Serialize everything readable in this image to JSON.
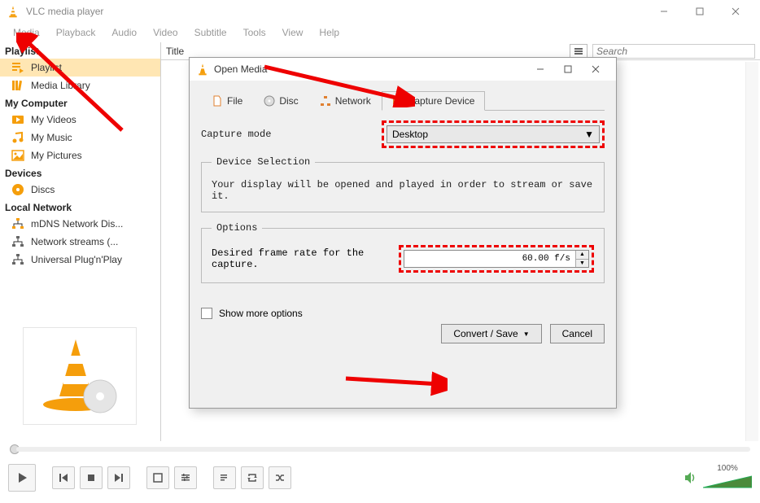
{
  "window": {
    "title": "VLC media player",
    "min_tip": "Minimize",
    "max_tip": "Maximize",
    "close_tip": "Close"
  },
  "menu": [
    "Media",
    "Playback",
    "Audio",
    "Video",
    "Subtitle",
    "Tools",
    "View",
    "Help"
  ],
  "sidebar": {
    "sections": [
      {
        "title": "Playlist",
        "items": [
          {
            "label": "Playlist",
            "selected": true
          },
          {
            "label": "Media Library"
          }
        ]
      },
      {
        "title": "My Computer",
        "items": [
          {
            "label": "My Videos"
          },
          {
            "label": "My Music"
          },
          {
            "label": "My Pictures"
          }
        ]
      },
      {
        "title": "Devices",
        "items": [
          {
            "label": "Discs"
          }
        ]
      },
      {
        "title": "Local Network",
        "items": [
          {
            "label": "mDNS Network Dis..."
          },
          {
            "label": "Network streams (..."
          },
          {
            "label": "Universal Plug'n'Play"
          }
        ]
      }
    ]
  },
  "list": {
    "col_title": "Title",
    "search_placeholder": "Search"
  },
  "volume": {
    "label": "100%"
  },
  "dialog": {
    "title": "Open Media",
    "tabs": {
      "file": "File",
      "disc": "Disc",
      "network": "Network",
      "capture": "Capture Device"
    },
    "capture_mode_label": "Capture mode",
    "capture_mode_value": "Desktop",
    "device_selection_legend": "Device Selection",
    "device_selection_text": "Your display will be opened and played in order to stream or save it.",
    "options_legend": "Options",
    "frame_rate_label": "Desired frame rate for the capture.",
    "frame_rate_value": "60.00 f/s",
    "show_more": "Show more options",
    "convert_save": "Convert / Save",
    "cancel": "Cancel"
  }
}
